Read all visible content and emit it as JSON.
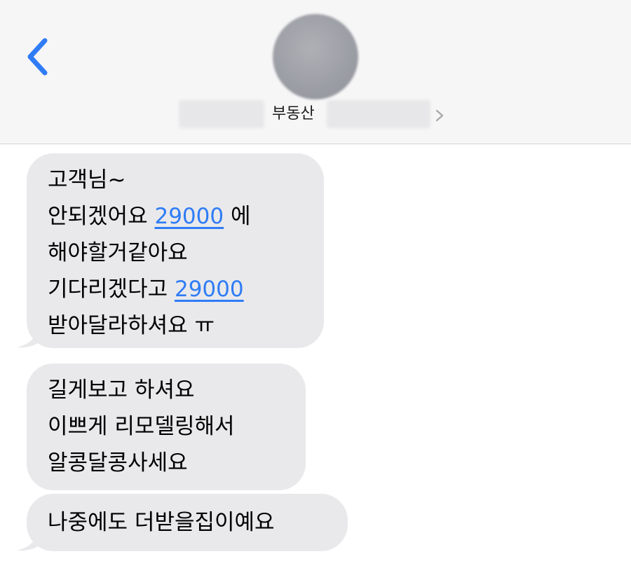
{
  "header": {
    "back_icon": "chevron-left-icon",
    "contact_name": "부동산",
    "contact_chevron_icon": "chevron-right-icon",
    "accent_color": "#2f7cf6"
  },
  "messages": [
    {
      "lines": [
        {
          "text": "고객님~"
        },
        {
          "prefix": "안되겠어요  ",
          "link": "29000",
          "suffix": " 에"
        },
        {
          "text": "해야할거같아요"
        },
        {
          "prefix": "기다리겠다고 ",
          "link": "29000",
          "suffix": ""
        },
        {
          "text": "받아달라하셔요 ㅠ"
        }
      ]
    },
    {
      "lines": [
        {
          "text": "길게보고 하셔요"
        },
        {
          "text": "이쁘게 리모델링해서"
        },
        {
          "text": "알콩달콩사세요"
        }
      ]
    },
    {
      "lines": [
        {
          "text": "나중에도 더받을집이예요"
        }
      ]
    }
  ]
}
